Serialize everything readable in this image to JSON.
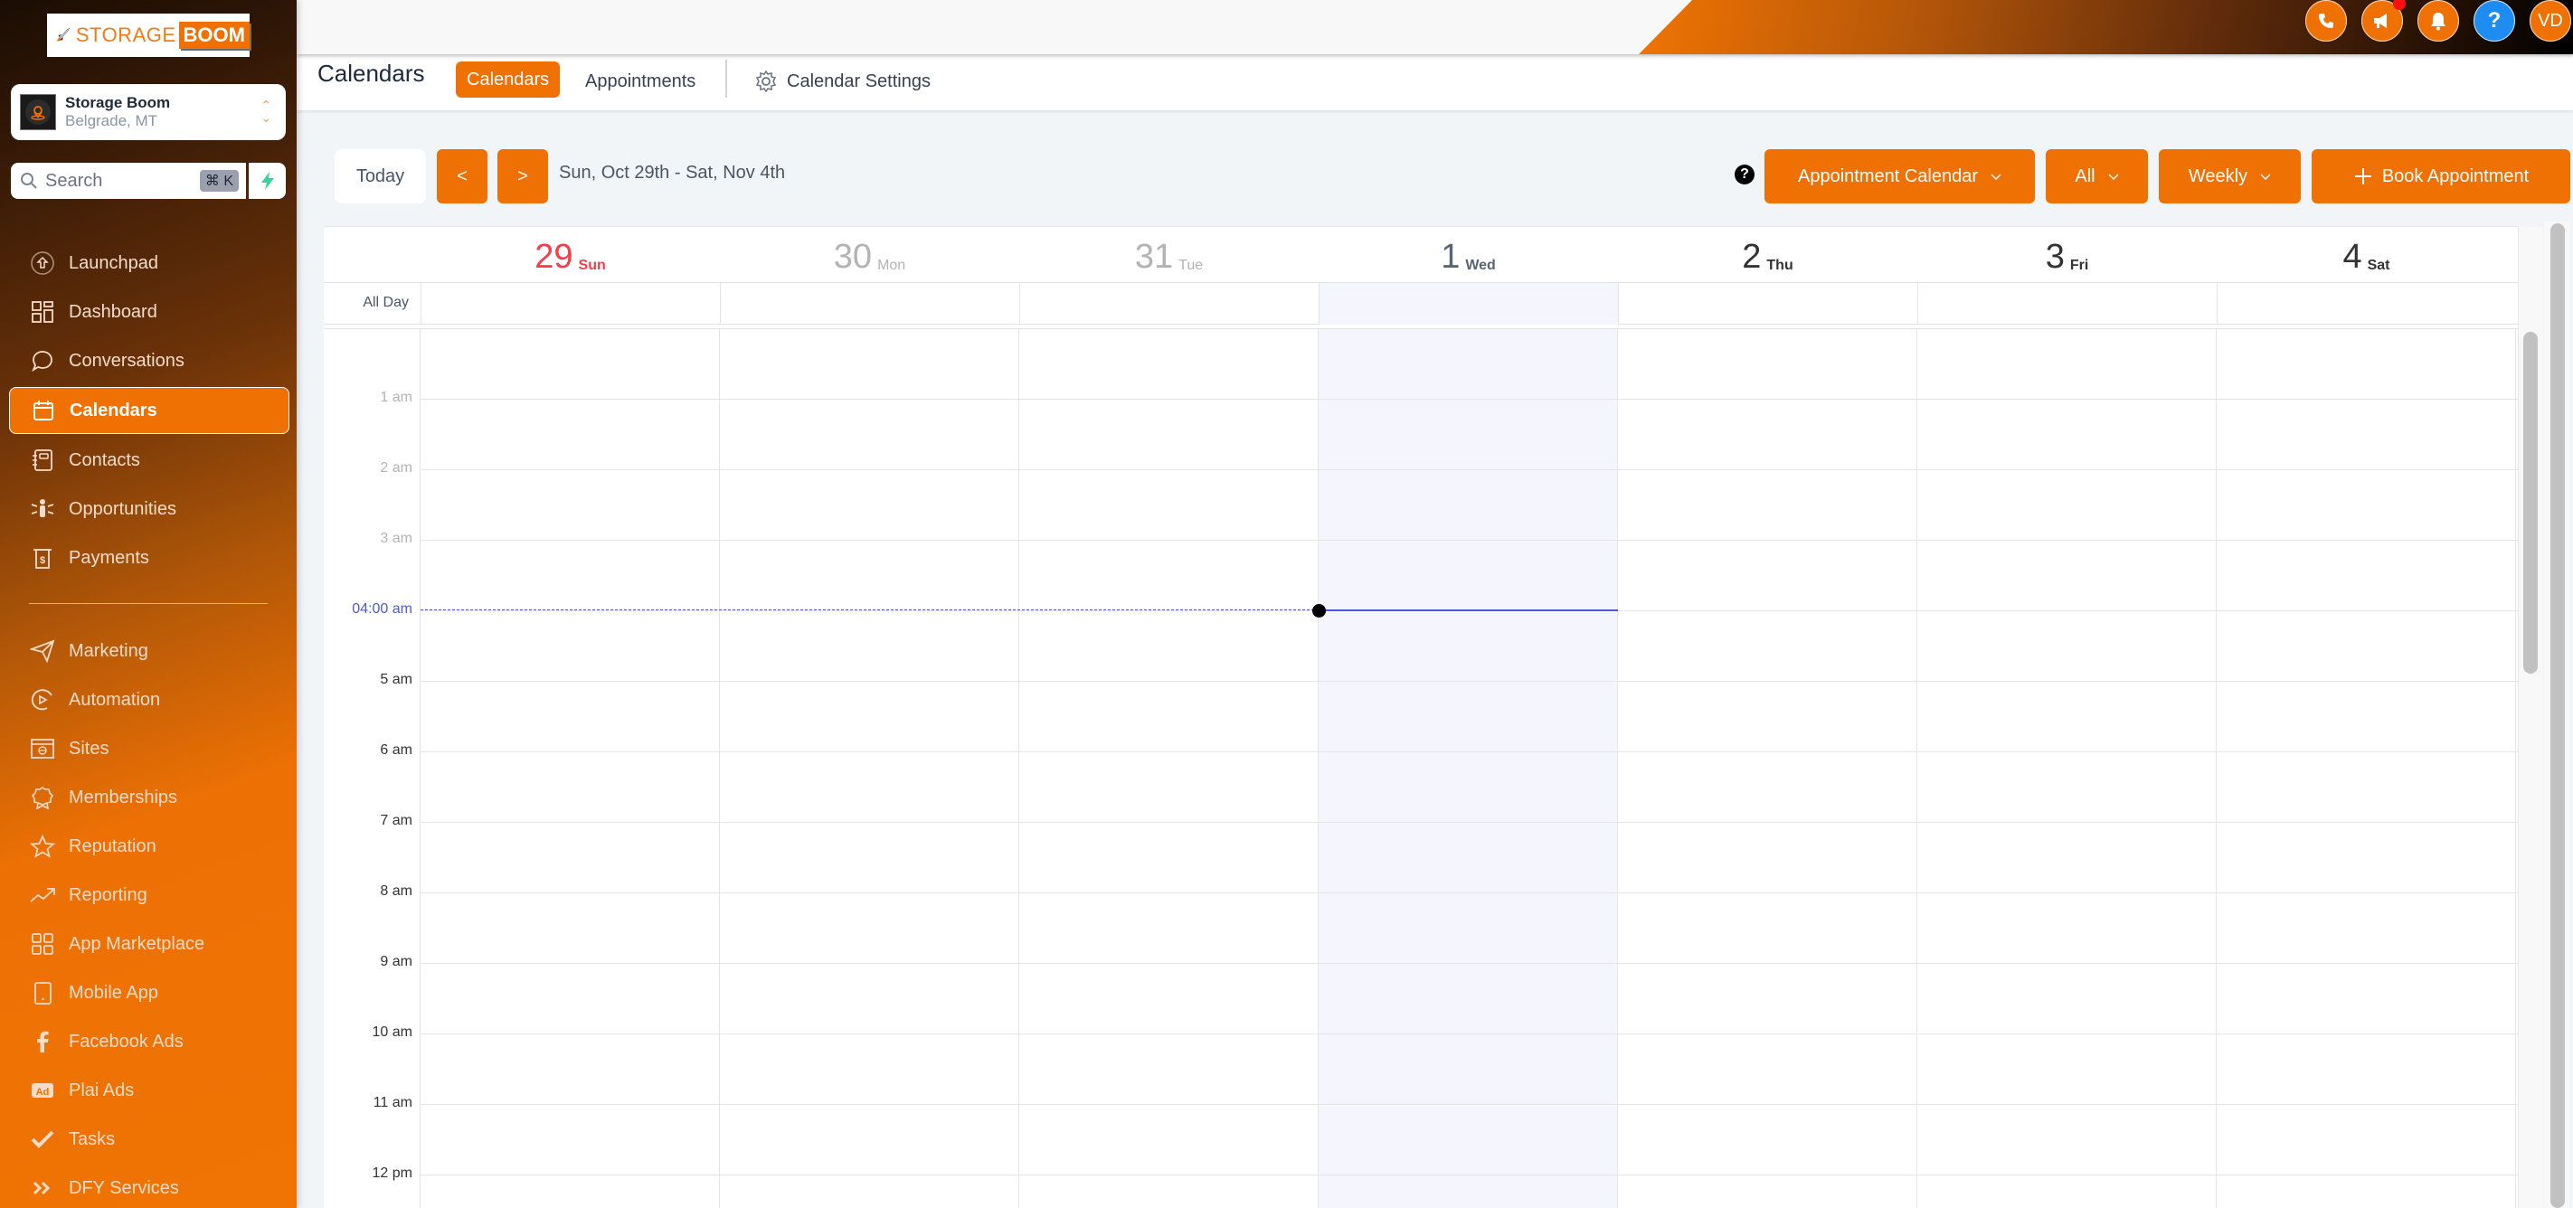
{
  "brand": {
    "logo_text_1": "STORAGE",
    "logo_text_2": "BOOM",
    "accent": "#ef7103"
  },
  "location": {
    "name": "Storage Boom",
    "city": "Belgrade, MT"
  },
  "search": {
    "placeholder": "Search",
    "shortcut": "⌘ K"
  },
  "sidebar": {
    "items": [
      {
        "label": "Launchpad",
        "icon": "launchpad-icon"
      },
      {
        "label": "Dashboard",
        "icon": "dashboard-icon"
      },
      {
        "label": "Conversations",
        "icon": "chat-icon"
      },
      {
        "label": "Calendars",
        "icon": "calendar-icon",
        "active": true
      },
      {
        "label": "Contacts",
        "icon": "contacts-icon"
      },
      {
        "label": "Opportunities",
        "icon": "opportunities-icon"
      },
      {
        "label": "Payments",
        "icon": "payments-icon"
      },
      {
        "label": "Marketing",
        "icon": "send-icon"
      },
      {
        "label": "Automation",
        "icon": "automation-icon"
      },
      {
        "label": "Sites",
        "icon": "sites-icon"
      },
      {
        "label": "Memberships",
        "icon": "badge-icon"
      },
      {
        "label": "Reputation",
        "icon": "star-icon"
      },
      {
        "label": "Reporting",
        "icon": "trend-icon"
      },
      {
        "label": "App Marketplace",
        "icon": "grid-icon"
      },
      {
        "label": "Mobile App",
        "icon": "mobile-icon"
      },
      {
        "label": "Facebook Ads",
        "icon": "facebook-icon"
      },
      {
        "label": "Plai Ads",
        "icon": "ad-icon"
      },
      {
        "label": "Tasks",
        "icon": "check-icon"
      },
      {
        "label": "DFY Services",
        "icon": "double-chevron-icon"
      }
    ]
  },
  "topbar": {
    "user_initials": "VD",
    "notification_dot": true
  },
  "header": {
    "title": "Calendars",
    "tabs": [
      {
        "label": "Calendars",
        "active": true
      },
      {
        "label": "Appointments",
        "active": false
      }
    ],
    "settings_label": "Calendar Settings"
  },
  "toolbar": {
    "today_label": "Today",
    "prev_label": "<",
    "next_label": ">",
    "date_range": "Sun, Oct 29th - Sat, Nov 4th",
    "calendar_select": "Appointment Calendar",
    "filter_select": "All",
    "view_select": "Weekly",
    "book_label": "Book Appointment"
  },
  "calendar": {
    "all_day_label": "All Day",
    "days": [
      {
        "num": "29",
        "name": "Sun",
        "state": "today"
      },
      {
        "num": "30",
        "name": "Mon",
        "state": "past"
      },
      {
        "num": "31",
        "name": "Tue",
        "state": "past"
      },
      {
        "num": "1",
        "name": "Wed",
        "state": "cur"
      },
      {
        "num": "2",
        "name": "Thu",
        "state": "future"
      },
      {
        "num": "3",
        "name": "Fri",
        "state": "future"
      },
      {
        "num": "4",
        "name": "Sat",
        "state": "future"
      }
    ],
    "hours": [
      {
        "label": "1 am",
        "faded": true
      },
      {
        "label": "2 am",
        "faded": true
      },
      {
        "label": "3 am",
        "faded": true
      },
      {
        "label": "04:00 am",
        "now": true
      },
      {
        "label": "5 am"
      },
      {
        "label": "6 am"
      },
      {
        "label": "7 am"
      },
      {
        "label": "8 am"
      },
      {
        "label": "9 am"
      },
      {
        "label": "10 am"
      },
      {
        "label": "11 am"
      },
      {
        "label": "12 pm"
      }
    ],
    "current_time": "04:00 am",
    "current_day_index": 3
  }
}
